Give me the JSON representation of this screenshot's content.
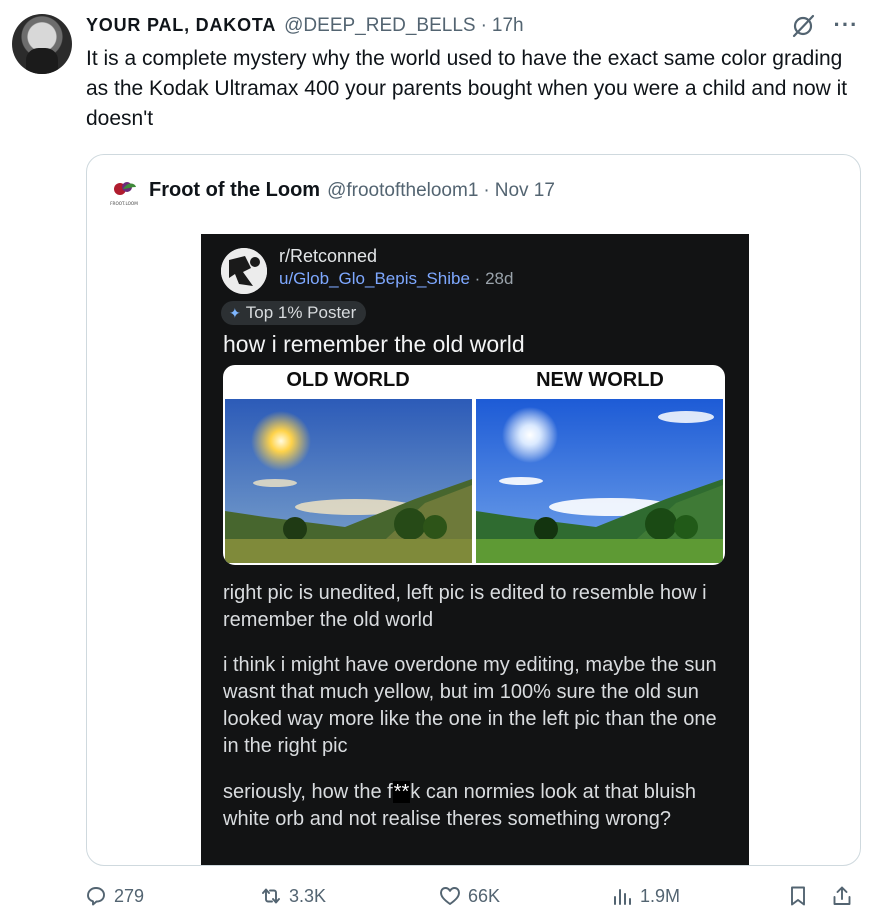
{
  "tweet": {
    "display_name": "YOUR PAL, DAKOTA",
    "handle": "@DEEP_RED_BELLS",
    "separator": "·",
    "time": "17h",
    "text": "It is a complete mystery why the world used to have the exact same color grading as the Kodak Ultramax 400 your parents bought when you were a child and now it doesn't"
  },
  "quote": {
    "name": "Froot of the Loom",
    "handle": "@frootoftheloom1",
    "separator": "·",
    "date": "Nov 17",
    "logo_text": "FROOT.LOOM"
  },
  "reddit": {
    "subreddit": "r/Retconned",
    "user": "u/Glob_Glo_Bepis_Shibe",
    "separator": "·",
    "age": "28d",
    "flair": "Top 1% Poster",
    "title": "how i remember the old world",
    "label_old": "OLD WORLD",
    "label_new": "NEW WORLD",
    "body1": "right pic is unedited, left pic is edited to resemble how i remember the old world",
    "body2": "i think i might have overdone my editing, maybe the sun wasnt that much yellow, but im 100% sure the old sun looked way more like the one in the left pic than the one in the right pic",
    "body3_a": "seriously, how the f",
    "body3_censor": "**",
    "body3_b": "k can normies look at that bluish white orb and not realise theres something wrong?"
  },
  "actions": {
    "replies": "279",
    "reposts": "3.3K",
    "likes": "66K",
    "views": "1.9M"
  },
  "icons": [
    "grok-icon",
    "more-icon",
    "reply-icon",
    "repost-icon",
    "like-icon",
    "views-icon",
    "bookmark-icon",
    "share-icon",
    "flair-icon"
  ],
  "colors": {
    "text": "#0f1419",
    "muted": "#536471",
    "card_border": "#cfd9de",
    "reddit_bg": "#121314",
    "reddit_link": "#7ea8ff"
  }
}
